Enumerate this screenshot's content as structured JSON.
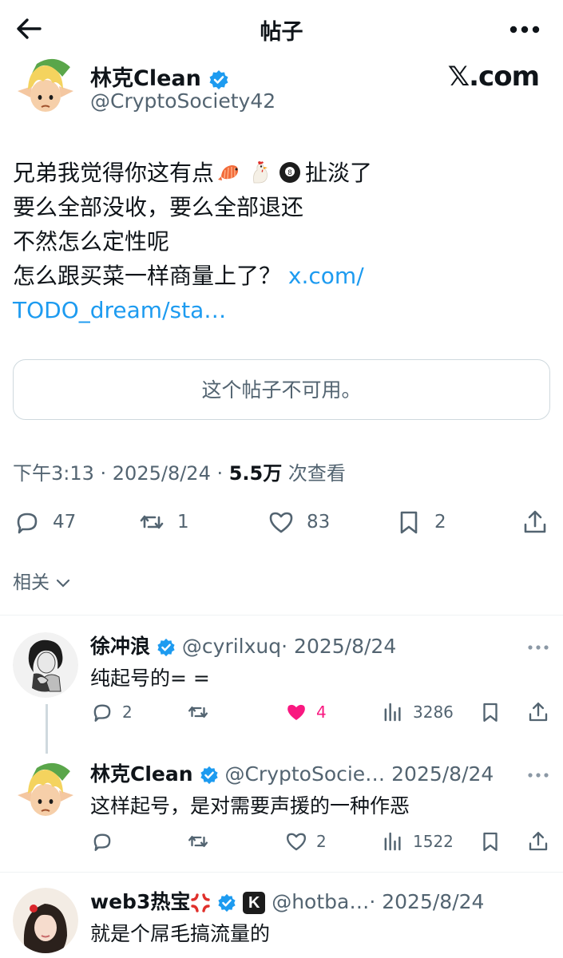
{
  "header": {
    "title": "帖子"
  },
  "post": {
    "author_name": "林克Clean",
    "author_handle": "@CryptoSociety42",
    "brand": "𝕏.com",
    "text_line1_start": "兄弟我觉得你这有点",
    "text_line1_end": "扯淡了",
    "text_line2": "要么全部没收，要么全部退还",
    "text_line3": "不然怎么定性呢",
    "text_line4": "怎么跟买菜一样商量上了？",
    "link_part1": "x.com/",
    "link_part2": "TODO_dream/sta…",
    "emojis": [
      "shrimp-emoji",
      "chicken-emoji",
      "billiard-8-ball-emoji"
    ],
    "unavailable_notice": "这个帖子不可用。",
    "time": "下午3:13 · 2025/8/24 · ",
    "views": "5.5万",
    "views_label": " 次查看",
    "replies": "47",
    "reposts": "1",
    "likes": "83",
    "bookmarks": "2"
  },
  "related_label": "相关",
  "replies": [
    {
      "name": "徐冲浪",
      "handle": "@cyrilxuq",
      "date": "· 2025/8/24",
      "text": "纯起号的= =",
      "replies": "2",
      "reposts": "",
      "likes": "4",
      "liked": true,
      "views": "3286"
    },
    {
      "name": "林克Clean",
      "handle": "@CryptoSocie…",
      "date": " 2025/8/24",
      "text": "这样起号，是对需要声援的一种作恶",
      "replies": "",
      "reposts": "",
      "likes": "2",
      "liked": false,
      "views": "1522"
    },
    {
      "name": "web3热宝",
      "badge_emoji": "anger-emoji",
      "badge_letter": "K",
      "handle": "@hotba…",
      "date": "· 2025/8/24",
      "text": "就是个屌毛搞流量的"
    }
  ],
  "colors": {
    "accent": "#1d9bf0",
    "like": "#f91880",
    "muted": "#536471",
    "text": "#0f1419"
  }
}
